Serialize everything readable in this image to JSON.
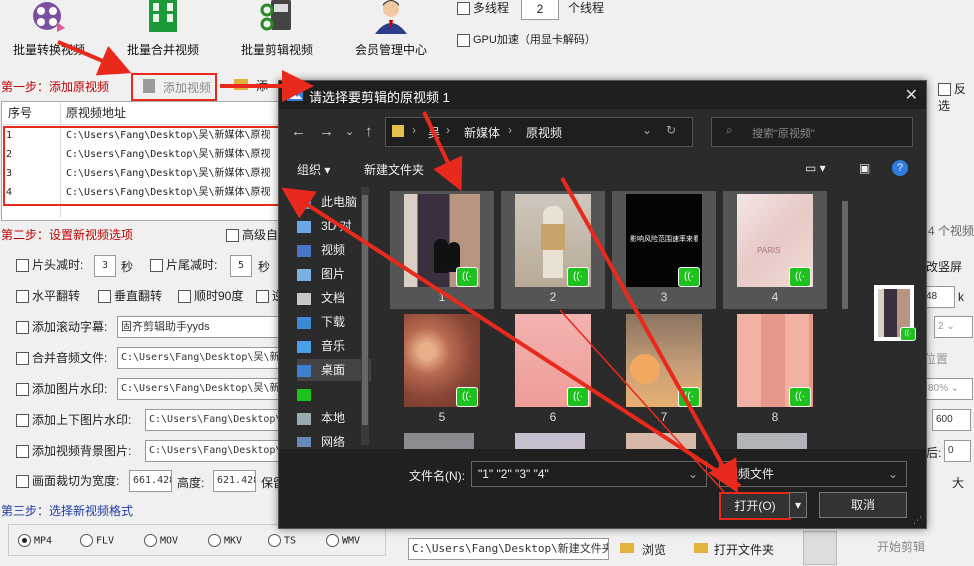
{
  "toolbar": {
    "batch_convert": "批量转换视频",
    "batch_merge": "批量合并视频",
    "batch_cut": "批量剪辑视频",
    "member_center": "会员管理中心",
    "multithread": "多线程",
    "thread_count": "2",
    "thread_unit": "个线程",
    "gpu": "GPU加速（用显卡解码）"
  },
  "step1": {
    "label": "第一步：添加原视频",
    "add_video": "添加视频",
    "add_partial": "添",
    "reverse_partial": "反选"
  },
  "table": {
    "col_index": "序号",
    "col_path": "原视频地址",
    "rows": [
      {
        "idx": "1",
        "path": "C:\\Users\\Fang\\Desktop\\吴\\新媒体\\原视"
      },
      {
        "idx": "2",
        "path": "C:\\Users\\Fang\\Desktop\\吴\\新媒体\\原视"
      },
      {
        "idx": "3",
        "path": "C:\\Users\\Fang\\Desktop\\吴\\新媒体\\原视"
      },
      {
        "idx": "4",
        "path": "C:\\Users\\Fang\\Desktop\\吴\\新媒体\\原视"
      }
    ]
  },
  "step2": {
    "label": "第二步：设置新视频选项",
    "advanced": "高级自",
    "video_count": "4 个视频",
    "head_cut": "片头减时:",
    "head_val": "3",
    "sec1": "秒",
    "tail_cut": "片尾减时:",
    "tail_val": "5",
    "sec2": "秒",
    "hflip": "水平翻转",
    "vflip": "垂直翻转",
    "rotate90": "顺时90度",
    "rotate_partial": "逆",
    "scroll_sub": "添加滚动字幕:",
    "scroll_sub_val": "固齐剪辑助手yyds",
    "merge_audio": "合并音频文件:",
    "merge_audio_val": "C:\\Users\\Fang\\Desktop\\吴\\新",
    "img_watermark": "添加图片水印:",
    "img_watermark_val": "C:\\Users\\Fang\\Desktop\\吴\\新",
    "updown_watermark": "添加上下图片水印:",
    "updown_val": "C:\\Users\\Fang\\Desktop\\",
    "bg_image": "添加视频背景图片:",
    "bg_val": "C:\\Users\\Fang\\Desktop\\",
    "crop": "画面裁切为宽度:",
    "crop_w": "661.428",
    "height_lbl": "高度:",
    "crop_h": "621.428",
    "keep": "保留"
  },
  "right_panel": {
    "vertical": "改竖屏",
    "val48": "48",
    "unit_k": "k",
    "sel2": "2",
    "pos": "位置",
    "pct": "80%",
    "val600": "600",
    "lbl_partial": "后:",
    "val0": "0",
    "big": "大"
  },
  "step3": {
    "label": "第三步：选择新视频格式",
    "formats": [
      "MP4",
      "FLV",
      "MOV",
      "MKV",
      "TS",
      "WMV"
    ],
    "output_path": "C:\\Users\\Fang\\Desktop\\新建文件夹",
    "browse": "浏览",
    "open_folder": "打开文件夹",
    "start": "开始剪辑"
  },
  "dialog": {
    "title": "请选择要剪辑的原视频 1",
    "breadcrumb": [
      "吴",
      "新媒体",
      "原视频"
    ],
    "search_placeholder": "搜索\"原视频\"",
    "organize": "组织",
    "new_folder": "新建文件夹",
    "sidebar": [
      "此电脑",
      "3D 对",
      "视频",
      "图片",
      "文档",
      "下载",
      "音乐",
      "桌面",
      "",
      "本地",
      "网络"
    ],
    "thumbs": [
      "1",
      "2",
      "3",
      "4",
      "5",
      "6",
      "7",
      "8"
    ],
    "thumb3_text": "影响风险范围速率来看吧！",
    "thumb4_text": "PARIS",
    "filename_label": "文件名(N):",
    "filename_value": "\"1\" \"2\" \"3\" \"4\"",
    "filetype": "视频文件",
    "open": "打开(O)",
    "cancel": "取消"
  },
  "colors": {
    "accent_red": "#e8291c",
    "badge_green": "#1ec21e",
    "dialog_bg": "#2b2b2b"
  }
}
